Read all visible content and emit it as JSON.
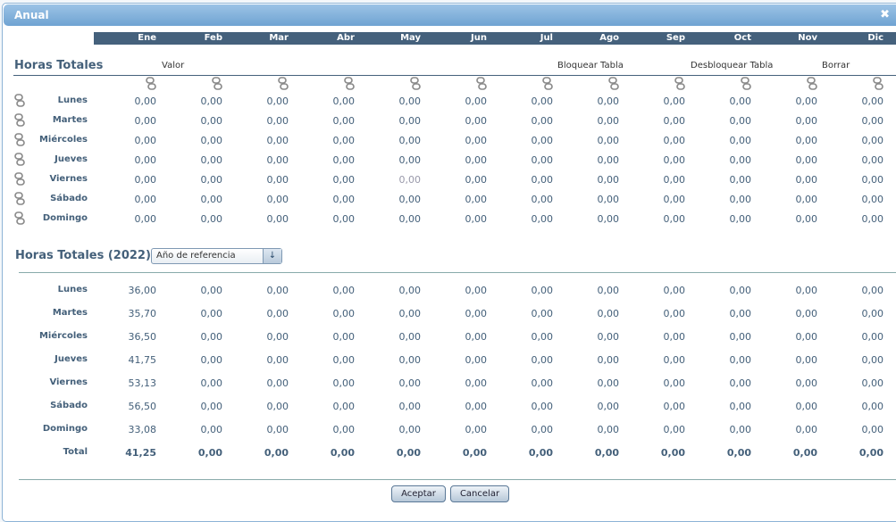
{
  "title": "Anual",
  "months": [
    "Ene",
    "Feb",
    "Mar",
    "Abr",
    "May",
    "Jun",
    "Jul",
    "Ago",
    "Sep",
    "Oct",
    "Nov",
    "Dic"
  ],
  "top": {
    "heading": "Horas Totales",
    "valor_label": "Valor",
    "lock_label": "Bloquear Tabla",
    "unlock_label": "Desbloquear Tabla",
    "clear_label": "Borrar",
    "rows": [
      {
        "label": "Lunes",
        "values": [
          "0,00",
          "0,00",
          "0,00",
          "0,00",
          "0,00",
          "0,00",
          "0,00",
          "0,00",
          "0,00",
          "0,00",
          "0,00",
          "0,00"
        ]
      },
      {
        "label": "Martes",
        "values": [
          "0,00",
          "0,00",
          "0,00",
          "0,00",
          "0,00",
          "0,00",
          "0,00",
          "0,00",
          "0,00",
          "0,00",
          "0,00",
          "0,00"
        ]
      },
      {
        "label": "Miércoles",
        "values": [
          "0,00",
          "0,00",
          "0,00",
          "0,00",
          "0,00",
          "0,00",
          "0,00",
          "0,00",
          "0,00",
          "0,00",
          "0,00",
          "0,00"
        ]
      },
      {
        "label": "Jueves",
        "values": [
          "0,00",
          "0,00",
          "0,00",
          "0,00",
          "0,00",
          "0,00",
          "0,00",
          "0,00",
          "0,00",
          "0,00",
          "0,00",
          "0,00"
        ]
      },
      {
        "label": "Viernes",
        "values": [
          "0,00",
          "0,00",
          "0,00",
          "0,00",
          "0,00",
          "0,00",
          "0,00",
          "0,00",
          "0,00",
          "0,00",
          "0,00",
          "0,00"
        ]
      },
      {
        "label": "Sábado",
        "values": [
          "0,00",
          "0,00",
          "0,00",
          "0,00",
          "0,00",
          "0,00",
          "0,00",
          "0,00",
          "0,00",
          "0,00",
          "0,00",
          "0,00"
        ]
      },
      {
        "label": "Domingo",
        "values": [
          "0,00",
          "0,00",
          "0,00",
          "0,00",
          "0,00",
          "0,00",
          "0,00",
          "0,00",
          "0,00",
          "0,00",
          "0,00",
          "0,00"
        ]
      }
    ]
  },
  "bottom": {
    "heading": "Horas Totales (2022)",
    "select_value": "Año de referencia",
    "rows": [
      {
        "label": "Lunes",
        "values": [
          "36,00",
          "0,00",
          "0,00",
          "0,00",
          "0,00",
          "0,00",
          "0,00",
          "0,00",
          "0,00",
          "0,00",
          "0,00",
          "0,00"
        ]
      },
      {
        "label": "Martes",
        "values": [
          "35,70",
          "0,00",
          "0,00",
          "0,00",
          "0,00",
          "0,00",
          "0,00",
          "0,00",
          "0,00",
          "0,00",
          "0,00",
          "0,00"
        ]
      },
      {
        "label": "Miércoles",
        "values": [
          "36,50",
          "0,00",
          "0,00",
          "0,00",
          "0,00",
          "0,00",
          "0,00",
          "0,00",
          "0,00",
          "0,00",
          "0,00",
          "0,00"
        ]
      },
      {
        "label": "Jueves",
        "values": [
          "41,75",
          "0,00",
          "0,00",
          "0,00",
          "0,00",
          "0,00",
          "0,00",
          "0,00",
          "0,00",
          "0,00",
          "0,00",
          "0,00"
        ]
      },
      {
        "label": "Viernes",
        "values": [
          "53,13",
          "0,00",
          "0,00",
          "0,00",
          "0,00",
          "0,00",
          "0,00",
          "0,00",
          "0,00",
          "0,00",
          "0,00",
          "0,00"
        ]
      },
      {
        "label": "Sábado",
        "values": [
          "56,50",
          "0,00",
          "0,00",
          "0,00",
          "0,00",
          "0,00",
          "0,00",
          "0,00",
          "0,00",
          "0,00",
          "0,00",
          "0,00"
        ]
      },
      {
        "label": "Domingo",
        "values": [
          "33,08",
          "0,00",
          "0,00",
          "0,00",
          "0,00",
          "0,00",
          "0,00",
          "0,00",
          "0,00",
          "0,00",
          "0,00",
          "0,00"
        ]
      },
      {
        "label": "Total",
        "values": [
          "41,25",
          "0,00",
          "0,00",
          "0,00",
          "0,00",
          "0,00",
          "0,00",
          "0,00",
          "0,00",
          "0,00",
          "0,00",
          "0,00"
        ]
      }
    ]
  },
  "buttons": {
    "ok": "Aceptar",
    "cancel": "Cancelar"
  }
}
